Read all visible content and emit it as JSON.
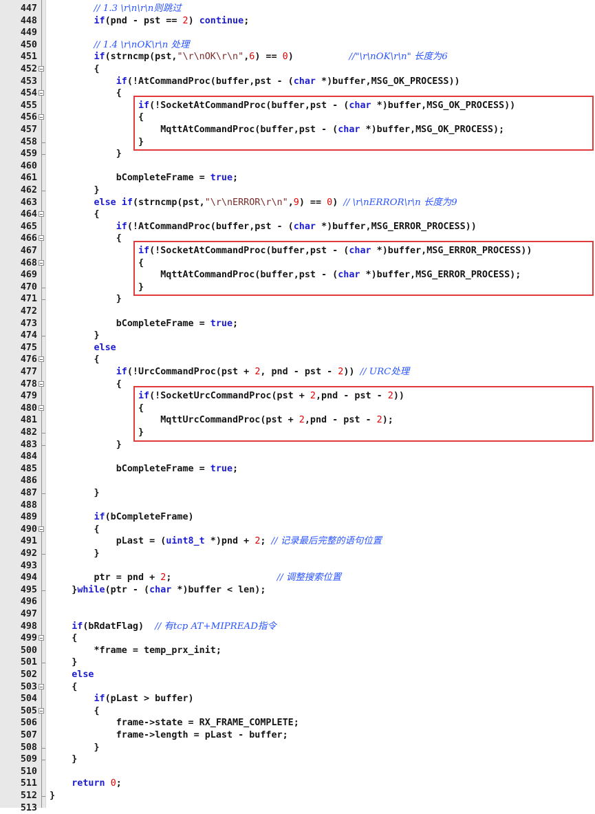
{
  "editor": {
    "colors": {
      "keyword": "#1b1bd0",
      "number": "#e00000",
      "comment": "#2a55ff",
      "string": "#7a2a2a",
      "highlight_box": "#e03a3a",
      "gutter": "#e8e8e8"
    },
    "fold_icon": "fold-minus-icon",
    "lines": [
      {
        "n": "447",
        "parts": [
          {
            "t": "        "
          },
          {
            "t": "// 1.3 \\r\\n\\r\\n则跳过",
            "c": "cmt"
          }
        ]
      },
      {
        "n": "448",
        "parts": [
          {
            "t": "        "
          },
          {
            "t": "if",
            "c": "kw"
          },
          {
            "t": "(pnd - pst == "
          },
          {
            "t": "2",
            "c": "num"
          },
          {
            "t": ") "
          },
          {
            "t": "continue",
            "c": "kw"
          },
          {
            "t": ";"
          }
        ]
      },
      {
        "n": "449",
        "parts": []
      },
      {
        "n": "450",
        "parts": [
          {
            "t": "        "
          },
          {
            "t": "// 1.4 \\r\\nOK\\r\\n 处理",
            "c": "cmt"
          }
        ]
      },
      {
        "n": "451",
        "parts": [
          {
            "t": "        "
          },
          {
            "t": "if",
            "c": "kw"
          },
          {
            "t": "(strncmp(pst,"
          },
          {
            "t": "\"\\r\\nOK\\r\\n\"",
            "c": "str"
          },
          {
            "t": ","
          },
          {
            "t": "6",
            "c": "num"
          },
          {
            "t": ") == "
          },
          {
            "t": "0",
            "c": "num"
          },
          {
            "t": ")          "
          },
          {
            "t": "//\"\\r\\nOK\\r\\n\" 长度为6",
            "c": "cmt"
          }
        ]
      },
      {
        "n": "452",
        "fold": true,
        "parts": [
          {
            "t": "        {"
          }
        ]
      },
      {
        "n": "453",
        "parts": [
          {
            "t": "            "
          },
          {
            "t": "if",
            "c": "kw"
          },
          {
            "t": "(!AtCommandProc(buffer,pst - ("
          },
          {
            "t": "char",
            "c": "kw"
          },
          {
            "t": " *)buffer,MSG_OK_PROCESS))"
          }
        ]
      },
      {
        "n": "454",
        "fold": true,
        "parts": [
          {
            "t": "            {"
          }
        ]
      },
      {
        "n": "455",
        "parts": [
          {
            "t": "                "
          },
          {
            "t": "if",
            "c": "kw"
          },
          {
            "t": "(!SocketAtCommandProc(buffer,pst - ("
          },
          {
            "t": "char",
            "c": "kw"
          },
          {
            "t": " *)buffer,MSG_OK_PROCESS))"
          }
        ]
      },
      {
        "n": "456",
        "fold": true,
        "parts": [
          {
            "t": "                {"
          }
        ]
      },
      {
        "n": "457",
        "parts": [
          {
            "t": "                    MqttAtCommandProc(buffer,pst - ("
          },
          {
            "t": "char",
            "c": "kw"
          },
          {
            "t": " *)buffer,MSG_OK_PROCESS);"
          }
        ]
      },
      {
        "n": "458",
        "foldEnd": true,
        "parts": [
          {
            "t": "                }"
          }
        ]
      },
      {
        "n": "459",
        "foldEnd": true,
        "parts": [
          {
            "t": "            }"
          }
        ]
      },
      {
        "n": "460",
        "parts": []
      },
      {
        "n": "461",
        "parts": [
          {
            "t": "            bCompleteFrame = "
          },
          {
            "t": "true",
            "c": "kw"
          },
          {
            "t": ";"
          }
        ]
      },
      {
        "n": "462",
        "foldEnd": true,
        "parts": [
          {
            "t": "        }"
          }
        ]
      },
      {
        "n": "463",
        "parts": [
          {
            "t": "        "
          },
          {
            "t": "else if",
            "c": "kw"
          },
          {
            "t": "(strncmp(pst,"
          },
          {
            "t": "\"\\r\\nERROR\\r\\n\"",
            "c": "str"
          },
          {
            "t": ","
          },
          {
            "t": "9",
            "c": "num"
          },
          {
            "t": ") == "
          },
          {
            "t": "0",
            "c": "num"
          },
          {
            "t": ") "
          },
          {
            "t": "// \\r\\nERROR\\r\\n 长度为9",
            "c": "cmt"
          }
        ]
      },
      {
        "n": "464",
        "fold": true,
        "parts": [
          {
            "t": "        {"
          }
        ]
      },
      {
        "n": "465",
        "parts": [
          {
            "t": "            "
          },
          {
            "t": "if",
            "c": "kw"
          },
          {
            "t": "(!AtCommandProc(buffer,pst - ("
          },
          {
            "t": "char",
            "c": "kw"
          },
          {
            "t": " *)buffer,MSG_ERROR_PROCESS))"
          }
        ]
      },
      {
        "n": "466",
        "fold": true,
        "parts": [
          {
            "t": "            {"
          }
        ]
      },
      {
        "n": "467",
        "parts": [
          {
            "t": "                "
          },
          {
            "t": "if",
            "c": "kw"
          },
          {
            "t": "(!SocketAtCommandProc(buffer,pst - ("
          },
          {
            "t": "char",
            "c": "kw"
          },
          {
            "t": " *)buffer,MSG_ERROR_PROCESS))"
          }
        ]
      },
      {
        "n": "468",
        "fold": true,
        "parts": [
          {
            "t": "                {"
          }
        ]
      },
      {
        "n": "469",
        "parts": [
          {
            "t": "                    MqttAtCommandProc(buffer,pst - ("
          },
          {
            "t": "char",
            "c": "kw"
          },
          {
            "t": " *)buffer,MSG_ERROR_PROCESS);"
          }
        ]
      },
      {
        "n": "470",
        "foldEnd": true,
        "parts": [
          {
            "t": "                }"
          }
        ]
      },
      {
        "n": "471",
        "foldEnd": true,
        "parts": [
          {
            "t": "            }"
          }
        ]
      },
      {
        "n": "472",
        "parts": []
      },
      {
        "n": "473",
        "parts": [
          {
            "t": "            bCompleteFrame = "
          },
          {
            "t": "true",
            "c": "kw"
          },
          {
            "t": ";"
          }
        ]
      },
      {
        "n": "474",
        "foldEnd": true,
        "parts": [
          {
            "t": "        }"
          }
        ]
      },
      {
        "n": "475",
        "parts": [
          {
            "t": "        "
          },
          {
            "t": "else",
            "c": "kw"
          }
        ]
      },
      {
        "n": "476",
        "fold": true,
        "parts": [
          {
            "t": "        {"
          }
        ]
      },
      {
        "n": "477",
        "parts": [
          {
            "t": "            "
          },
          {
            "t": "if",
            "c": "kw"
          },
          {
            "t": "(!UrcCommandProc(pst + "
          },
          {
            "t": "2",
            "c": "num"
          },
          {
            "t": ", pnd - pst - "
          },
          {
            "t": "2",
            "c": "num"
          },
          {
            "t": ")) "
          },
          {
            "t": "// URC处理",
            "c": "cmt"
          }
        ]
      },
      {
        "n": "478",
        "fold": true,
        "parts": [
          {
            "t": "            {"
          }
        ]
      },
      {
        "n": "479",
        "parts": [
          {
            "t": "                "
          },
          {
            "t": "if",
            "c": "kw"
          },
          {
            "t": "(!SocketUrcCommandProc(pst + "
          },
          {
            "t": "2",
            "c": "num"
          },
          {
            "t": ",pnd - pst - "
          },
          {
            "t": "2",
            "c": "num"
          },
          {
            "t": "))"
          }
        ]
      },
      {
        "n": "480",
        "fold": true,
        "parts": [
          {
            "t": "                {"
          }
        ]
      },
      {
        "n": "481",
        "parts": [
          {
            "t": "                    MqttUrcCommandProc(pst + "
          },
          {
            "t": "2",
            "c": "num"
          },
          {
            "t": ",pnd - pst - "
          },
          {
            "t": "2",
            "c": "num"
          },
          {
            "t": ");"
          }
        ]
      },
      {
        "n": "482",
        "foldEnd": true,
        "parts": [
          {
            "t": "                }"
          }
        ]
      },
      {
        "n": "483",
        "foldEnd": true,
        "parts": [
          {
            "t": "            }"
          }
        ]
      },
      {
        "n": "484",
        "parts": []
      },
      {
        "n": "485",
        "parts": [
          {
            "t": "            bCompleteFrame = "
          },
          {
            "t": "true",
            "c": "kw"
          },
          {
            "t": ";"
          }
        ]
      },
      {
        "n": "486",
        "parts": []
      },
      {
        "n": "487",
        "foldEnd": true,
        "parts": [
          {
            "t": "        }"
          }
        ]
      },
      {
        "n": "488",
        "parts": []
      },
      {
        "n": "489",
        "parts": [
          {
            "t": "        "
          },
          {
            "t": "if",
            "c": "kw"
          },
          {
            "t": "(bCompleteFrame)"
          }
        ]
      },
      {
        "n": "490",
        "fold": true,
        "parts": [
          {
            "t": "        {"
          }
        ]
      },
      {
        "n": "491",
        "parts": [
          {
            "t": "            pLast = ("
          },
          {
            "t": "uint8_t",
            "c": "kw"
          },
          {
            "t": " *)pnd + "
          },
          {
            "t": "2",
            "c": "num"
          },
          {
            "t": "; "
          },
          {
            "t": "// 记录最后完整的语句位置",
            "c": "cmt"
          }
        ]
      },
      {
        "n": "492",
        "foldEnd": true,
        "parts": [
          {
            "t": "        }"
          }
        ]
      },
      {
        "n": "493",
        "parts": []
      },
      {
        "n": "494",
        "parts": [
          {
            "t": "        ptr = pnd + "
          },
          {
            "t": "2",
            "c": "num"
          },
          {
            "t": ";                   "
          },
          {
            "t": "// 调整搜索位置",
            "c": "cmt"
          }
        ]
      },
      {
        "n": "495",
        "foldEnd": true,
        "parts": [
          {
            "t": "    }"
          },
          {
            "t": "while",
            "c": "kw"
          },
          {
            "t": "(ptr - ("
          },
          {
            "t": "char",
            "c": "kw"
          },
          {
            "t": " *)buffer < len);"
          }
        ]
      },
      {
        "n": "496",
        "parts": []
      },
      {
        "n": "497",
        "parts": []
      },
      {
        "n": "498",
        "parts": [
          {
            "t": "    "
          },
          {
            "t": "if",
            "c": "kw"
          },
          {
            "t": "(bRdatFlag)  "
          },
          {
            "t": "// 有tcp AT+MIPREAD指令",
            "c": "cmt"
          }
        ]
      },
      {
        "n": "499",
        "fold": true,
        "parts": [
          {
            "t": "    {"
          }
        ]
      },
      {
        "n": "500",
        "parts": [
          {
            "t": "        *frame = temp_prx_init;"
          }
        ]
      },
      {
        "n": "501",
        "foldEnd": true,
        "parts": [
          {
            "t": "    }"
          }
        ]
      },
      {
        "n": "502",
        "parts": [
          {
            "t": "    "
          },
          {
            "t": "else",
            "c": "kw"
          }
        ]
      },
      {
        "n": "503",
        "fold": true,
        "parts": [
          {
            "t": "    {"
          }
        ]
      },
      {
        "n": "504",
        "parts": [
          {
            "t": "        "
          },
          {
            "t": "if",
            "c": "kw"
          },
          {
            "t": "(pLast > buffer)"
          }
        ]
      },
      {
        "n": "505",
        "fold": true,
        "parts": [
          {
            "t": "        {"
          }
        ]
      },
      {
        "n": "506",
        "parts": [
          {
            "t": "            frame->state = RX_FRAME_COMPLETE;"
          }
        ]
      },
      {
        "n": "507",
        "parts": [
          {
            "t": "            frame->length = pLast - buffer;"
          }
        ]
      },
      {
        "n": "508",
        "foldEnd": true,
        "parts": [
          {
            "t": "        }"
          }
        ]
      },
      {
        "n": "509",
        "foldEnd": true,
        "parts": [
          {
            "t": "    }"
          }
        ]
      },
      {
        "n": "510",
        "parts": []
      },
      {
        "n": "511",
        "parts": [
          {
            "t": "    "
          },
          {
            "t": "return",
            "c": "kw"
          },
          {
            "t": " "
          },
          {
            "t": "0",
            "c": "num"
          },
          {
            "t": ";"
          }
        ]
      },
      {
        "n": "512",
        "foldEnd": true,
        "parts": [
          {
            "t": "}"
          }
        ]
      },
      {
        "n": "513",
        "parts": []
      }
    ],
    "highlights": [
      {
        "from": "455",
        "to": "458"
      },
      {
        "from": "467",
        "to": "470"
      },
      {
        "from": "479",
        "to": "482"
      }
    ]
  }
}
